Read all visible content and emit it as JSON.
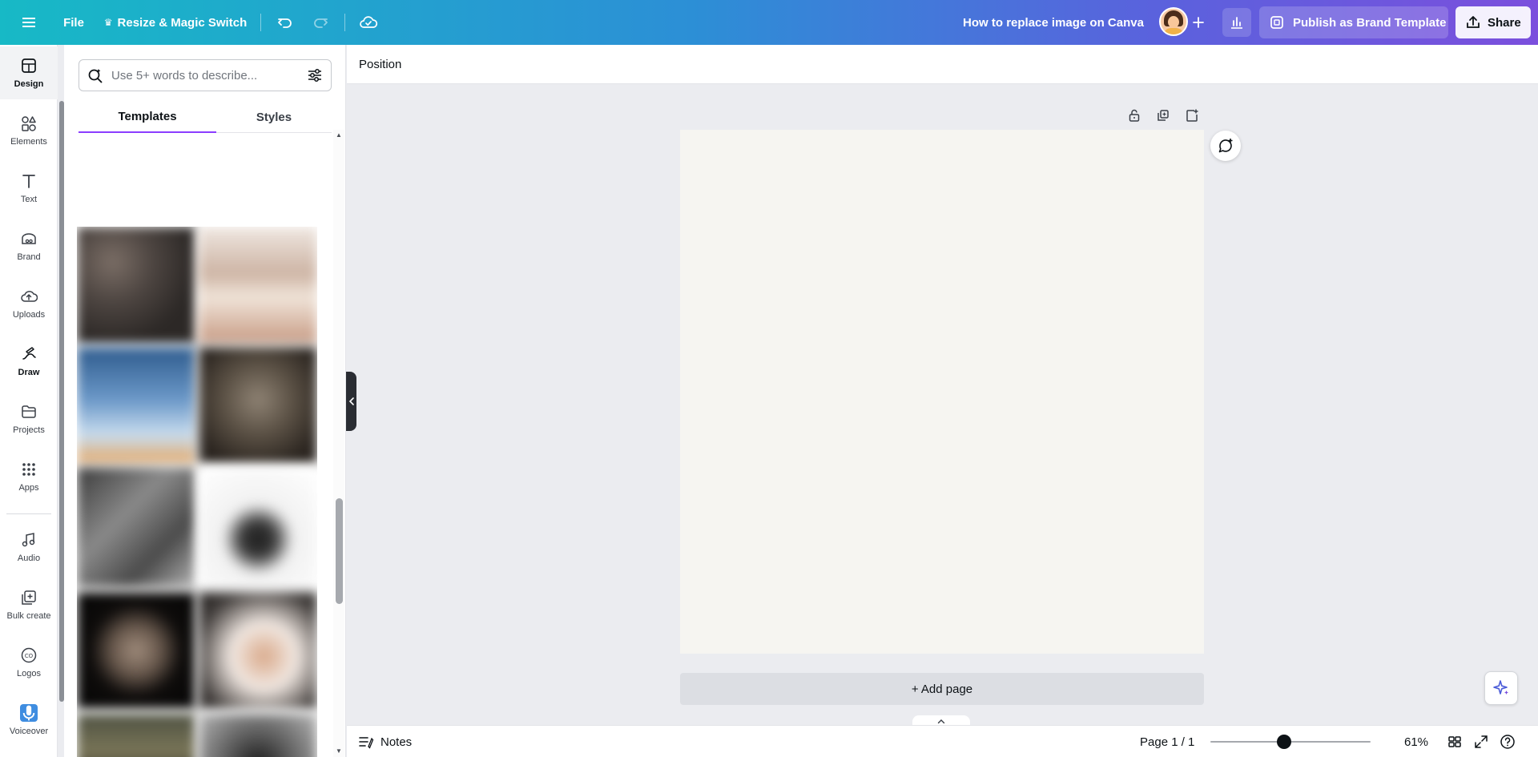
{
  "topbar": {
    "file_label": "File",
    "resize_label": "Resize & Magic Switch",
    "doc_title": "How to replace image on Canva",
    "publish_label": "Publish as Brand Template",
    "share_label": "Share",
    "gradient_start": "#17b9c6",
    "gradient_end": "#7b4fdd"
  },
  "rail": {
    "items": [
      {
        "label": "Design",
        "icon": "design-icon",
        "active": true
      },
      {
        "label": "Elements",
        "icon": "elements-icon"
      },
      {
        "label": "Text",
        "icon": "text-icon"
      },
      {
        "label": "Brand",
        "icon": "brand-icon"
      },
      {
        "label": "Uploads",
        "icon": "uploads-icon"
      },
      {
        "label": "Draw",
        "icon": "draw-icon"
      },
      {
        "label": "Projects",
        "icon": "projects-icon"
      },
      {
        "label": "Apps",
        "icon": "apps-icon"
      },
      {
        "label": "Audio",
        "icon": "audio-icon"
      },
      {
        "label": "Bulk create",
        "icon": "bulk-create-icon"
      },
      {
        "label": "Logos",
        "icon": "logos-icon"
      },
      {
        "label": "Voiceover",
        "icon": "voiceover-icon"
      }
    ]
  },
  "panel": {
    "search_placeholder": "Use 5+ words to describe...",
    "tabs": [
      "Templates",
      "Styles"
    ],
    "active_tab": "Templates",
    "accent": "#8b3dff"
  },
  "context_bar": {
    "position_label": "Position"
  },
  "canvas": {
    "page_color": "#f6f5f1",
    "add_page_label": "+ Add page"
  },
  "footer": {
    "notes_label": "Notes",
    "page_indicator": "Page 1 / 1",
    "zoom_label": "61%",
    "zoom_level": 0.61
  }
}
